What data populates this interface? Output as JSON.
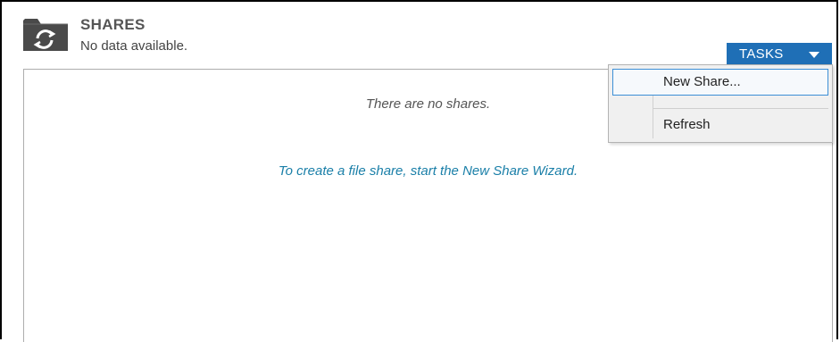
{
  "header": {
    "title": "SHARES",
    "subtitle": "No data available.",
    "icon": "shared-folder-icon"
  },
  "tasks": {
    "label": "TASKS",
    "caret_icon": "caret-down-icon",
    "accent_color": "#1f6fb6"
  },
  "content": {
    "empty_message": "There are no shares.",
    "wizard_link": "To create a file share, start the New Share Wizard.",
    "link_color": "#1a7fa8"
  },
  "menu": {
    "items": [
      {
        "label": "New Share...",
        "highlighted": true
      },
      {
        "label": "Refresh",
        "highlighted": false
      }
    ]
  }
}
